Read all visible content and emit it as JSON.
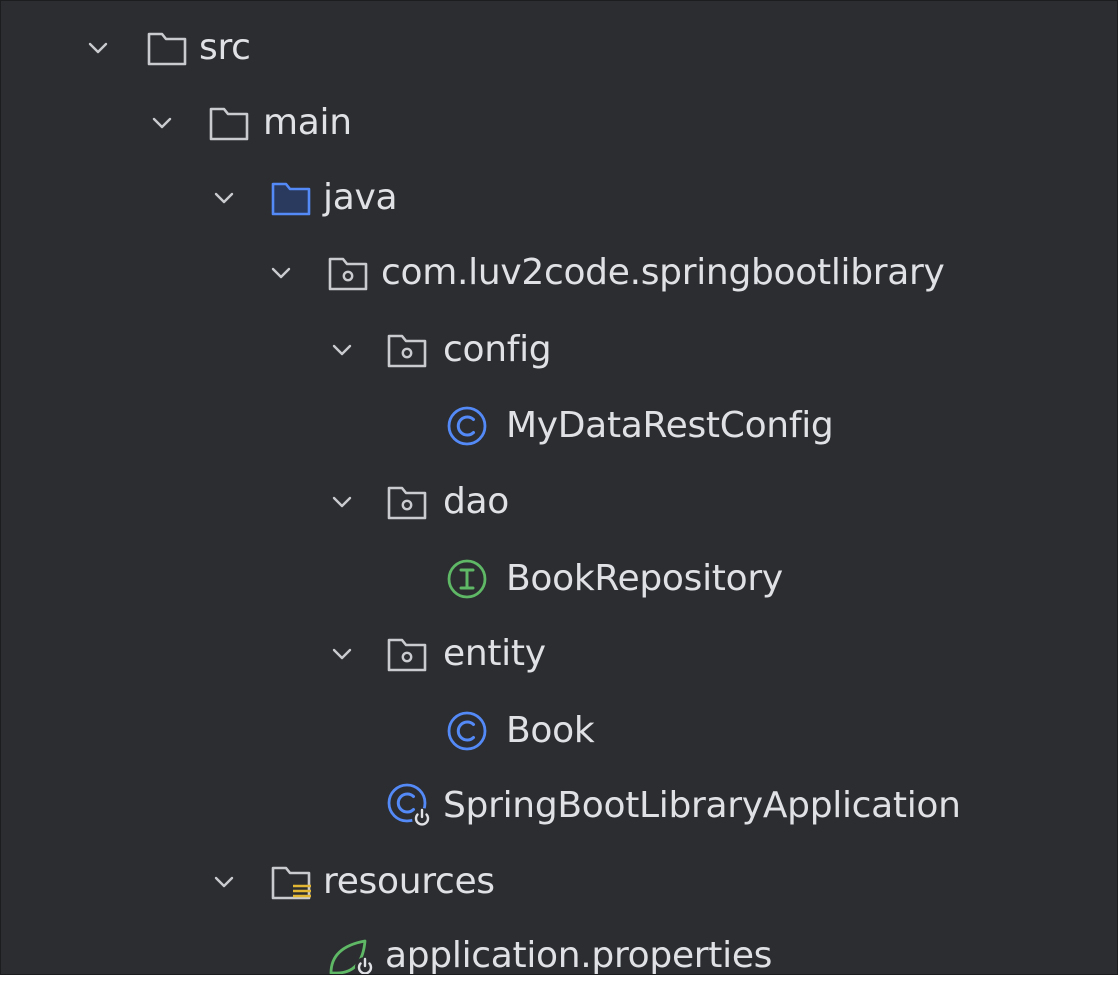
{
  "project_tree": {
    "src": "src",
    "main": "main",
    "java": "java",
    "package": "com.luv2code.springbootlibrary",
    "config": "config",
    "my_data_rest_config": "MyDataRestConfig",
    "dao": "dao",
    "book_repository": "BookRepository",
    "entity": "entity",
    "book": "Book",
    "application_class": "SpringBootLibraryApplication",
    "resources": "resources",
    "application_properties": "application.properties"
  },
  "colors": {
    "background": "#2b2d30",
    "text": "#dfe1e5",
    "folder_icon": "#c9cbcf",
    "source_folder_icon": "#548af7",
    "class_icon": "#548af7",
    "interface_icon": "#5fb865",
    "spring_icon": "#5fb865"
  }
}
